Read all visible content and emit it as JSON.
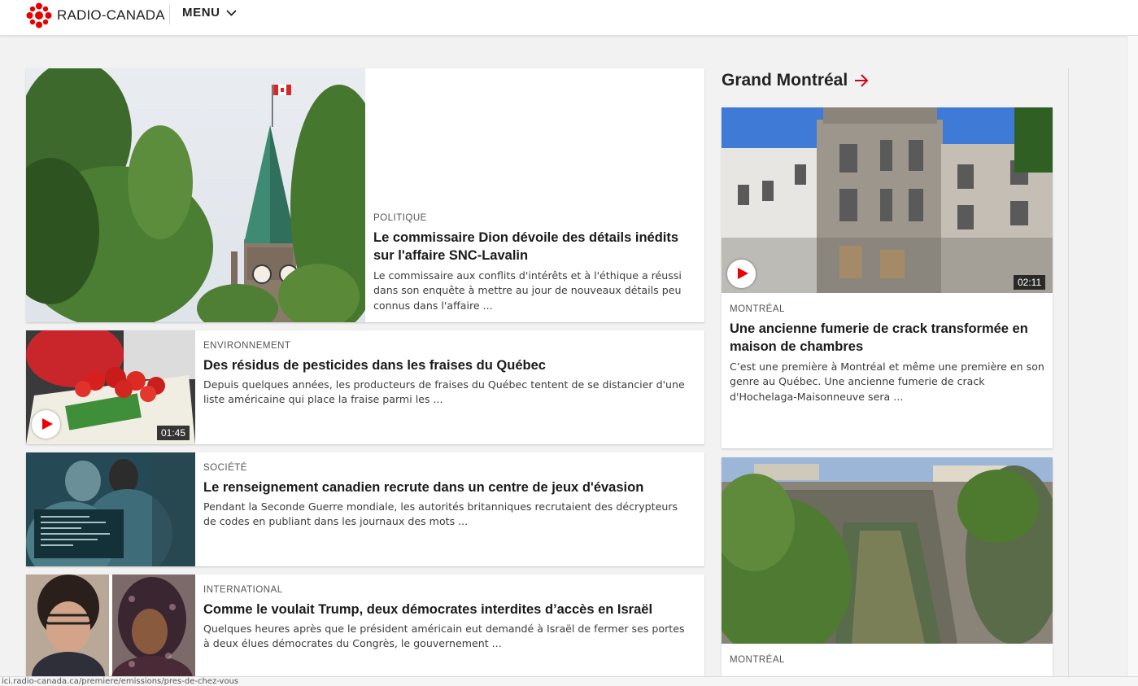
{
  "header": {
    "brand": "RADIO-CANADA",
    "menu_label": "MENU"
  },
  "featured": {
    "rubric": "POLITIQUE",
    "headline": "Le commissaire Dion dévoile des détails inédits sur l'affaire SNC-Lavalin",
    "summary": "Le commissaire aux conflits d'intérêts et à l'éthique a réussi dans son enquête à mettre au jour de nouveaux détails peu connus dans l'affaire ..."
  },
  "stories": [
    {
      "rubric": "ENVIRONNEMENT",
      "headline": "Des résidus de pesticides dans les fraises du Québec",
      "summary": "Depuis quelques années, les producteurs de fraises du Québec tentent de se distancier d'une liste américaine qui place la fraise parmi les ...",
      "duration": "01:45"
    },
    {
      "rubric": "SOCIÉTÉ",
      "headline": "Le renseignement canadien recrute dans un centre de jeux d'évasion",
      "summary": "Pendant la Seconde Guerre mondiale, les autorités britanniques recrutaient des décrypteurs de codes en publiant dans les journaux des mots ..."
    },
    {
      "rubric": "INTERNATIONAL",
      "headline": "Comme le voulait Trump, deux démocrates interdites d’accès en Israël",
      "summary": "Quelques heures après que le président américain eut demandé à Israël de fermer ses portes à deux élues démocrates du Congrès, le gouvernement ..."
    }
  ],
  "regional": {
    "title": "Grand Montréal",
    "cards": [
      {
        "rubric": "MONTRÉAL",
        "headline": "Une ancienne fumerie de crack transformée en maison de chambres",
        "summary": "C’est une première à Montréal et même une première en son genre au Québec. Une ancienne fumerie de crack d'Hochelaga-Maisonneuve sera ...",
        "duration": "02:11"
      },
      {
        "rubric": "MONTRÉAL"
      }
    ]
  },
  "status_url": "ici.radio-canada.ca/premiere/emissions/pres-de-chez-vous",
  "colors": {
    "brand_red": "#e60000",
    "accent_arrow": "#d0021b"
  }
}
